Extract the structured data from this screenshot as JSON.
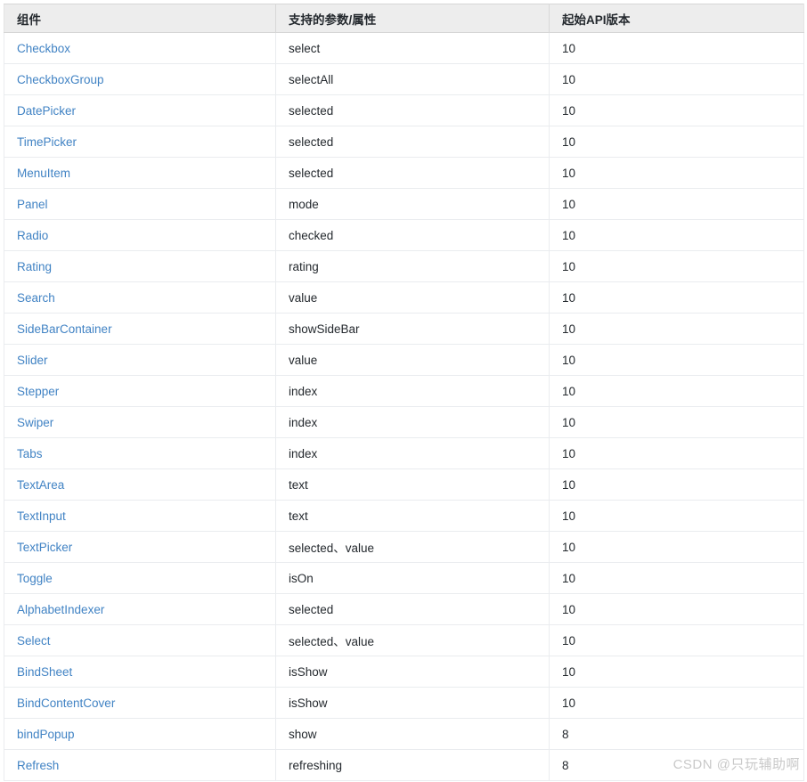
{
  "table": {
    "columns": [
      {
        "id": "component",
        "label": "组件"
      },
      {
        "id": "params",
        "label": "支持的参数/属性"
      },
      {
        "id": "api_version",
        "label": "起始API版本"
      }
    ],
    "rows": [
      {
        "component": "Checkbox",
        "params": "select",
        "api_version": "10"
      },
      {
        "component": "CheckboxGroup",
        "params": "selectAll",
        "api_version": "10"
      },
      {
        "component": "DatePicker",
        "params": "selected",
        "api_version": "10"
      },
      {
        "component": "TimePicker",
        "params": "selected",
        "api_version": "10"
      },
      {
        "component": "MenuItem",
        "params": "selected",
        "api_version": "10"
      },
      {
        "component": "Panel",
        "params": "mode",
        "api_version": "10"
      },
      {
        "component": "Radio",
        "params": "checked",
        "api_version": "10"
      },
      {
        "component": "Rating",
        "params": "rating",
        "api_version": "10"
      },
      {
        "component": "Search",
        "params": "value",
        "api_version": "10"
      },
      {
        "component": "SideBarContainer",
        "params": "showSideBar",
        "api_version": "10"
      },
      {
        "component": "Slider",
        "params": "value",
        "api_version": "10"
      },
      {
        "component": "Stepper",
        "params": "index",
        "api_version": "10"
      },
      {
        "component": "Swiper",
        "params": "index",
        "api_version": "10"
      },
      {
        "component": "Tabs",
        "params": "index",
        "api_version": "10"
      },
      {
        "component": "TextArea",
        "params": "text",
        "api_version": "10"
      },
      {
        "component": "TextInput",
        "params": "text",
        "api_version": "10"
      },
      {
        "component": "TextPicker",
        "params": "selected、value",
        "api_version": "10"
      },
      {
        "component": "Toggle",
        "params": "isOn",
        "api_version": "10"
      },
      {
        "component": "AlphabetIndexer",
        "params": "selected",
        "api_version": "10"
      },
      {
        "component": "Select",
        "params": "selected、value",
        "api_version": "10"
      },
      {
        "component": "BindSheet",
        "params": "isShow",
        "api_version": "10"
      },
      {
        "component": "BindContentCover",
        "params": "isShow",
        "api_version": "10"
      },
      {
        "component": "bindPopup",
        "params": "show",
        "api_version": "8"
      },
      {
        "component": "Refresh",
        "params": "refreshing",
        "api_version": "8"
      }
    ]
  },
  "watermark": {
    "text": "CSDN @只玩辅助啊"
  },
  "colors": {
    "link": "#4183c4",
    "header_bg": "#ededed",
    "row_border": "#eaecef",
    "text": "#24292e",
    "watermark": "#c9c9c9"
  }
}
